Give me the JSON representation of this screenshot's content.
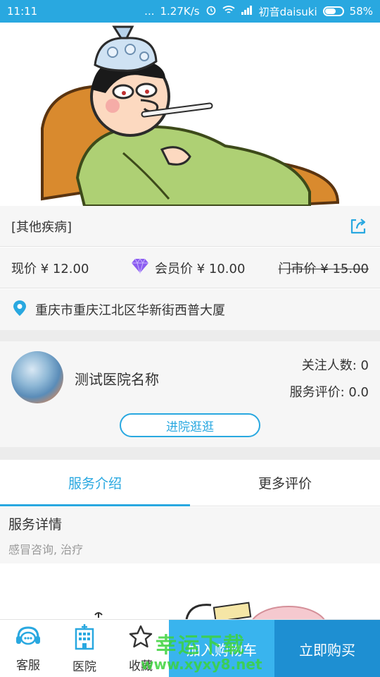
{
  "status_bar": {
    "time": "11:11",
    "dots": "...",
    "speed": "1.27K/s",
    "carrier": "初音daisuki",
    "battery": "58%"
  },
  "banner": {
    "slide_count": 2,
    "active_index": 1
  },
  "product": {
    "title": "[其他疾病]"
  },
  "price": {
    "now": "现价 ¥ 12.00",
    "member": "会员价 ¥ 10.00",
    "market": "门市价 ¥ 15.00"
  },
  "address": "重庆市重庆江北区华新街西普大厦",
  "hospital": {
    "name": "测试医院名称",
    "followers": "关注人数: 0",
    "rating": "服务评价: 0.0",
    "enter_button": "进院逛逛"
  },
  "tabs": [
    {
      "label": "服务介绍",
      "active": true
    },
    {
      "label": "更多评价",
      "active": false
    }
  ],
  "detail": {
    "title": "服务详情",
    "text": "感冒咨询, 治疗"
  },
  "bottom_bar": {
    "service": "客服",
    "hospital": "医院",
    "favorite": "收藏",
    "add_to_cart": "加入购物车",
    "buy_now": "立即购买"
  },
  "watermark": {
    "line1": "幸运下载",
    "line2": "www.xyxy8.net"
  },
  "colors": {
    "accent": "#29a8e0",
    "cart": "#39b4ee",
    "buy": "#1e8fd2"
  }
}
